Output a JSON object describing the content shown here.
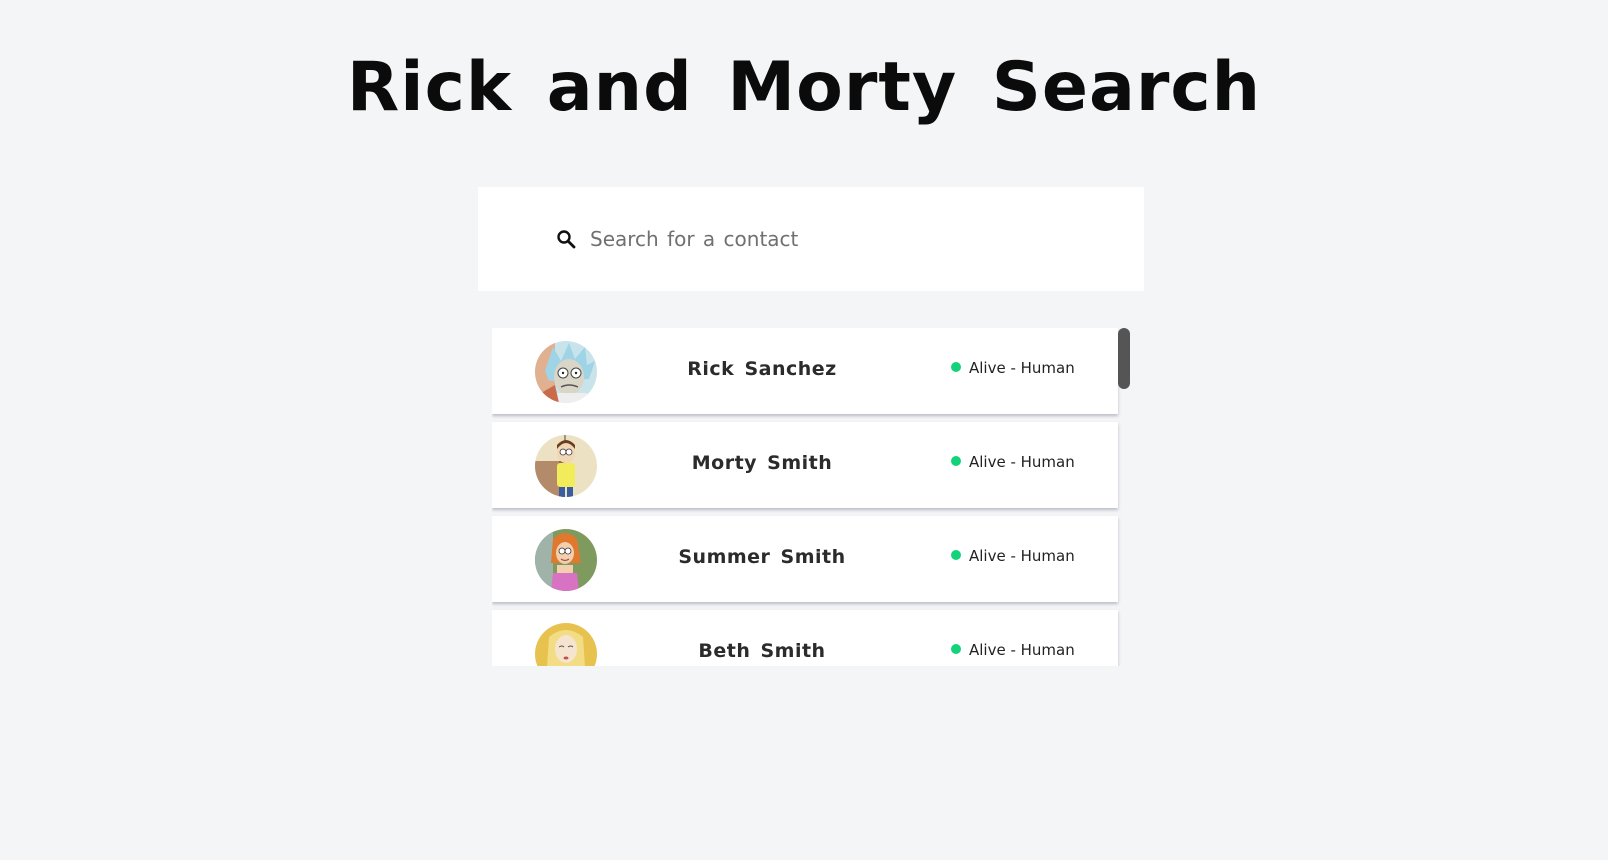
{
  "header": {
    "title": "Rick and Morty Search"
  },
  "search": {
    "placeholder": "Search for a contact",
    "value": "",
    "icon": "search-icon"
  },
  "characters": [
    {
      "name": "Rick Sanchez",
      "status": "Alive",
      "species": "Human",
      "status_color": "#12d27a",
      "status_text": "Alive - Human"
    },
    {
      "name": "Morty Smith",
      "status": "Alive",
      "species": "Human",
      "status_color": "#12d27a",
      "status_text": "Alive - Human"
    },
    {
      "name": "Summer Smith",
      "status": "Alive",
      "species": "Human",
      "status_color": "#12d27a",
      "status_text": "Alive - Human"
    },
    {
      "name": "Beth Smith",
      "status": "Alive",
      "species": "Human",
      "status_color": "#12d27a",
      "status_text": "Alive - Human"
    }
  ],
  "theme": {
    "background": "#f4f5f7",
    "card": "#ffffff",
    "alive_dot": "#12d27a",
    "scrollbar": "#555555"
  }
}
